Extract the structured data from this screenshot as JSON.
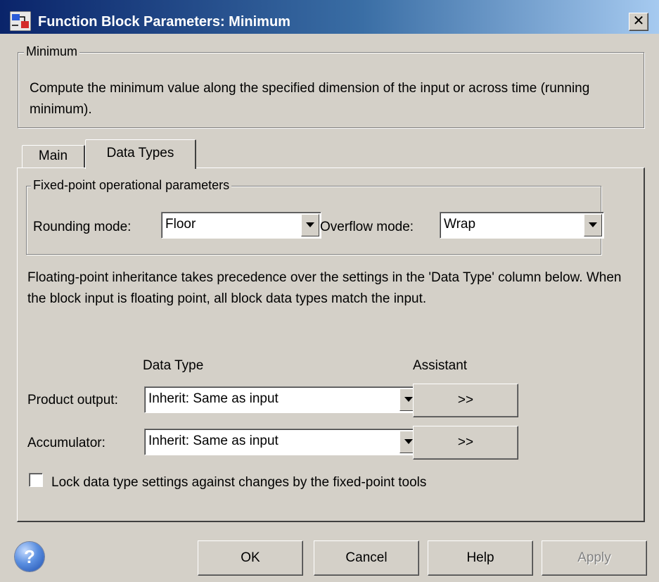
{
  "window": {
    "title": "Function Block Parameters: Minimum",
    "close_label": "✕"
  },
  "description": {
    "legend": "Minimum",
    "text": "Compute the minimum value along the specified dimension of the input or across time (running minimum)."
  },
  "tabs": [
    {
      "label": "Main",
      "selected": false
    },
    {
      "label": "Data Types",
      "selected": true
    }
  ],
  "fixed_point": {
    "legend": "Fixed-point operational parameters",
    "rounding_label": "Rounding mode:",
    "rounding_value": "Floor",
    "overflow_label": "Overflow mode:",
    "overflow_value": "Wrap"
  },
  "note": "Floating-point inheritance takes precedence over the settings in the 'Data Type' column below. When the block input is floating point, all block data types match the input.",
  "data_types": {
    "header_data_type": "Data Type",
    "header_assistant": "Assistant",
    "rows": [
      {
        "label": "Product output:",
        "value": "Inherit: Same as input",
        "assistant": ">>"
      },
      {
        "label": "Accumulator:",
        "value": "Inherit: Same as input",
        "assistant": ">>"
      }
    ]
  },
  "lock": {
    "label": "Lock data type settings against changes by the fixed-point tools",
    "checked": false
  },
  "buttons": {
    "help_icon": "?",
    "ok": "OK",
    "cancel": "Cancel",
    "help": "Help",
    "apply": "Apply",
    "apply_enabled": false
  },
  "icons": {
    "app": "simulink-block-icon",
    "help": "help-question-icon"
  },
  "colors": {
    "title_bar_start": "#0a246a",
    "title_bar_end": "#a6caf0",
    "dialog_bg": "#d4d0c8"
  }
}
